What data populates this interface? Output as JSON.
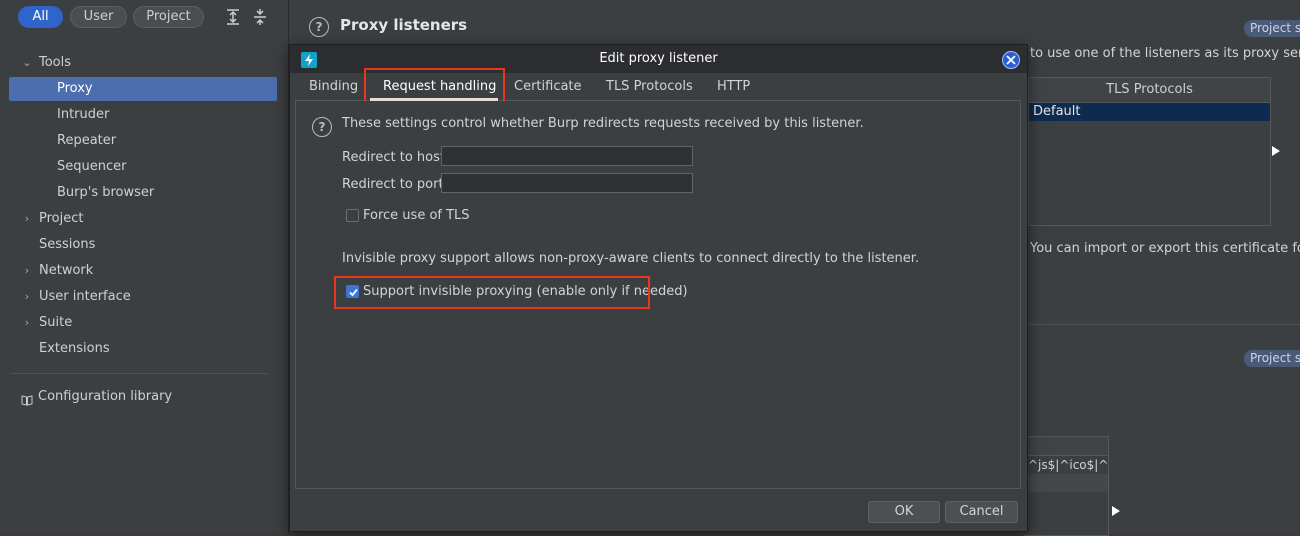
{
  "sidebar": {
    "scope_filters": [
      "All",
      "User",
      "Project"
    ],
    "active_filter": "All",
    "icons": [
      "expand-all-icon",
      "collapse-all-icon"
    ],
    "tree": [
      {
        "label": "Tools",
        "expanded": true
      },
      {
        "label": "Proxy",
        "selected": true
      },
      {
        "label": "Intruder"
      },
      {
        "label": "Repeater"
      },
      {
        "label": "Sequencer"
      },
      {
        "label": "Burp's browser"
      },
      {
        "label": "Project",
        "expandable": true
      },
      {
        "label": "Sessions"
      },
      {
        "label": "Network",
        "expandable": true
      },
      {
        "label": "User interface",
        "expandable": true
      },
      {
        "label": "Suite",
        "expandable": true
      },
      {
        "label": "Extensions"
      }
    ],
    "config_library": "Configuration library"
  },
  "background": {
    "section_title": "Proxy listeners",
    "badge": "Project s",
    "badge2": "Project s",
    "description_fragment": "to use one of the listeners as its proxy server.",
    "table": {
      "header": "TLS Protocols",
      "rows": [
        "Default"
      ]
    },
    "certificate_text": "You can import or export this certificate for use",
    "lower_table_cell": "^js$|^ico$|^..."
  },
  "dialog": {
    "title": "Edit proxy listener",
    "tabs": [
      "Binding",
      "Request handling",
      "Certificate",
      "TLS Protocols",
      "HTTP"
    ],
    "active_tab": "Request handling",
    "intro": "These settings control whether Burp redirects requests received by this listener.",
    "redirect_host_label": "Redirect to host:",
    "redirect_host_value": "",
    "redirect_port_label": "Redirect to port:",
    "redirect_port_value": "",
    "force_tls_label": "Force use of TLS",
    "force_tls_checked": false,
    "invisible_desc": "Invisible proxy support allows non-proxy-aware clients to connect directly to the listener.",
    "invisible_label": "Support invisible proxying (enable only if needed)",
    "invisible_checked": true,
    "ok_label": "OK",
    "cancel_label": "Cancel"
  },
  "colors": {
    "accent_blue": "#2f65ca",
    "selection": "#4b6eaf",
    "highlight_red": "#e8371b",
    "checkbox_blue": "#3d75d6",
    "app_icon": "#13a3c4"
  }
}
